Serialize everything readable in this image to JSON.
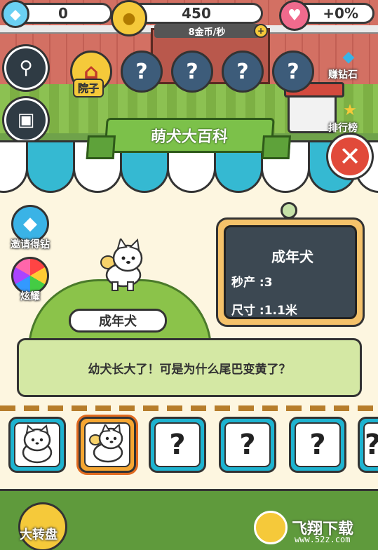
{
  "hud": {
    "gems": "0",
    "gold": "450",
    "gold_rate": "8金币/秒",
    "bonus": "+0%"
  },
  "nav": {
    "yard_label": "院子",
    "locked_room": "?",
    "earn_gems_label": "赚钻石",
    "ranking_label": "排行榜"
  },
  "panel": {
    "title": "萌犬大百科",
    "close_symbol": "✕",
    "invite_label": "邀请得钻",
    "glory_label": "炫耀"
  },
  "dog": {
    "name": "成年犬",
    "info_title": "成年犬",
    "production_label": "秒产 :3",
    "size_label": "尺寸 :1.1米",
    "description": "幼犬长大了！可是为什么尾巴变黄了？"
  },
  "collection": [
    {
      "state": "unlocked",
      "name": "puppy"
    },
    {
      "state": "selected",
      "name": "adult-dog"
    },
    {
      "state": "locked",
      "symbol": "?"
    },
    {
      "state": "locked",
      "symbol": "?"
    },
    {
      "state": "locked",
      "symbol": "?"
    },
    {
      "state": "locked",
      "symbol": "?"
    }
  ],
  "bottom": {
    "wheel_label": "大转盘"
  },
  "watermark": {
    "brand": "飞翔下载",
    "site": "www.52z.com"
  },
  "colors": {
    "accent_blue": "#35b9d2",
    "title_green": "#7cc14a",
    "close_red": "#e14a3a",
    "selected_orange": "#f5a632"
  }
}
